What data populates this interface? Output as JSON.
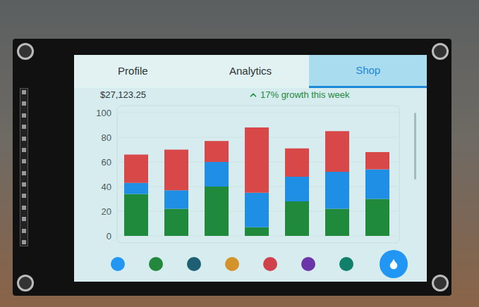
{
  "tabs": [
    {
      "label": "Profile",
      "selected": false
    },
    {
      "label": "Analytics",
      "selected": false
    },
    {
      "label": "Shop",
      "selected": true
    }
  ],
  "summary": {
    "amount": "$27,123.25",
    "growth": "17% growth this week"
  },
  "chart": {
    "y_ticks": [
      "100",
      "80",
      "60",
      "40",
      "20",
      "0"
    ],
    "y_max": 100,
    "series": [
      {
        "name": "green",
        "color": "#1f8a3c",
        "values": [
          34,
          22,
          40,
          7,
          28,
          22,
          30
        ]
      },
      {
        "name": "blue",
        "color": "#1f8fe6",
        "values": [
          9,
          15,
          20,
          28,
          20,
          30,
          24
        ]
      },
      {
        "name": "red",
        "color": "#d84848",
        "values": [
          23,
          33,
          17,
          53,
          23,
          33,
          14
        ]
      }
    ]
  },
  "palette": [
    {
      "color": "#2196f3",
      "selected": false
    },
    {
      "color": "#23883c",
      "selected": false
    },
    {
      "color": "#1e5f74",
      "selected": false
    },
    {
      "color": "#d4932a",
      "selected": false
    },
    {
      "color": "#d0414b",
      "selected": false
    },
    {
      "color": "#6a35a8",
      "selected": false
    },
    {
      "color": "#11806a",
      "selected": false
    }
  ]
}
